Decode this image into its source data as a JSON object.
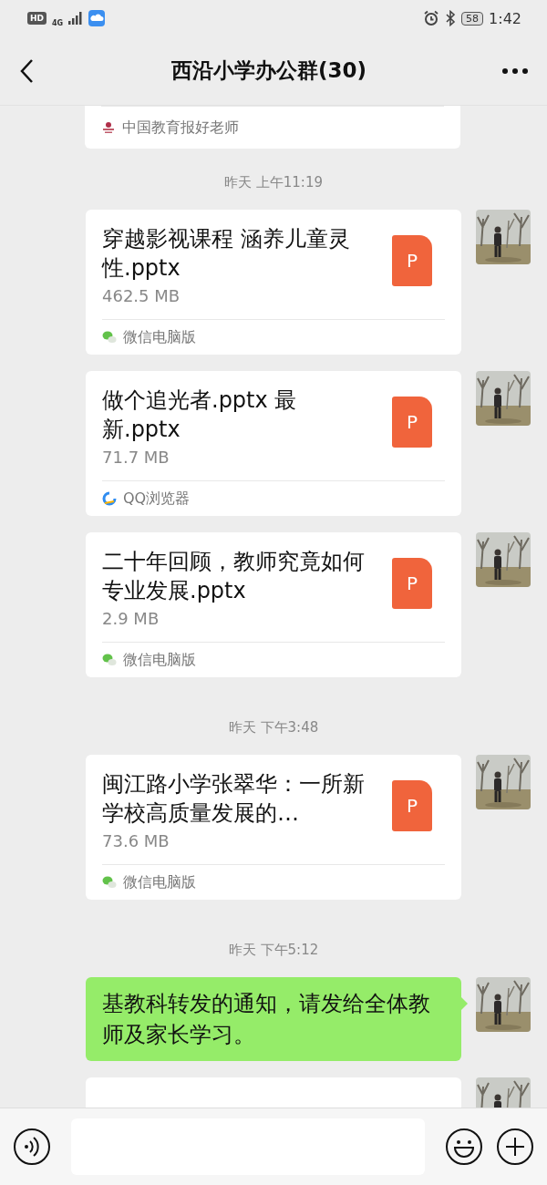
{
  "status_bar": {
    "hd": "HD",
    "network": "4G",
    "battery": "58",
    "time": "1:42"
  },
  "header": {
    "title": "西沿小学办公群(30)"
  },
  "messages": [
    {
      "kind": "source_tail",
      "source": {
        "kind": "cnedu",
        "label": "中国教育报好老师"
      }
    },
    {
      "kind": "time",
      "text": "昨天 上午11:19"
    },
    {
      "kind": "file",
      "name": "穿越影视课程  涵养儿童灵性.pptx",
      "size": "462.5 MB",
      "icon_letter": "P",
      "source": {
        "kind": "wechat",
        "label": "微信电脑版"
      }
    },
    {
      "kind": "file",
      "name": "做个追光者.pptx 最新.pptx",
      "size": "71.7 MB",
      "icon_letter": "P",
      "source": {
        "kind": "qqbrowser",
        "label": "QQ浏览器"
      }
    },
    {
      "kind": "file",
      "name": "二十年回顾，教师究竟如何专业发展.pptx",
      "size": "2.9 MB",
      "icon_letter": "P",
      "source": {
        "kind": "wechat",
        "label": "微信电脑版"
      }
    },
    {
      "kind": "time",
      "text": "昨天 下午3:48"
    },
    {
      "kind": "file",
      "name": "闽江路小学张翠华：一所新学校高质量发展的…",
      "size": "73.6 MB",
      "icon_letter": "P",
      "source": {
        "kind": "wechat",
        "label": "微信电脑版"
      }
    },
    {
      "kind": "time",
      "text": "昨天 下午5:12"
    },
    {
      "kind": "text",
      "text": "基教科转发的通知，请发给全体教师及家长学习。"
    },
    {
      "kind": "cut"
    }
  ]
}
